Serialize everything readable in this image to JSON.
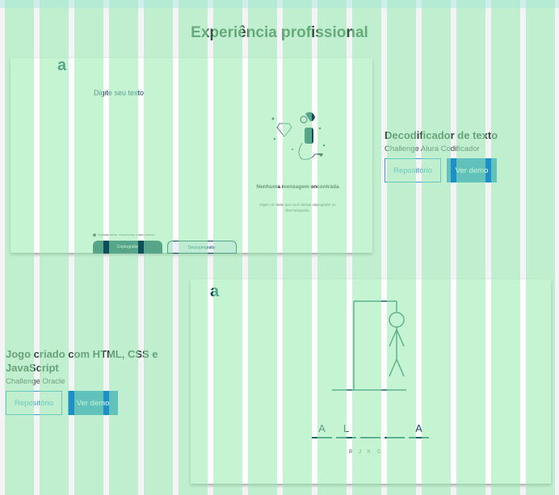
{
  "section_title": "Experiência profissional",
  "projects": [
    {
      "title": "Decodificador de texto",
      "subtitle": "Challenge Alura Codificador",
      "repo_label": "Repositório",
      "demo_label": "Ver demo",
      "preview": {
        "logo": "a",
        "input_placeholder": "Digite seu texto",
        "note": "Apenas letras minúsculas e sem acento",
        "encrypt_label": "Criptografar",
        "decrypt_label": "Descriptografar",
        "empty_title": "Nenhuma mensagem encontrada",
        "empty_text": "Digite um texto que você deseja criptografar ou descriptografar."
      }
    },
    {
      "title": "Jogo criado com HTML, CSS e JavaScript",
      "subtitle": "Challenge Oracle",
      "repo_label": "Repositório",
      "demo_label": "Ver demo",
      "preview": {
        "logo": "a",
        "letters": [
          "A",
          "L",
          "",
          "",
          "A"
        ],
        "wrong_letters": [
          "B",
          "J",
          "K",
          "C"
        ]
      }
    }
  ],
  "colors": {
    "accent": "#1e90c8",
    "brand": "#0a4f5a"
  }
}
